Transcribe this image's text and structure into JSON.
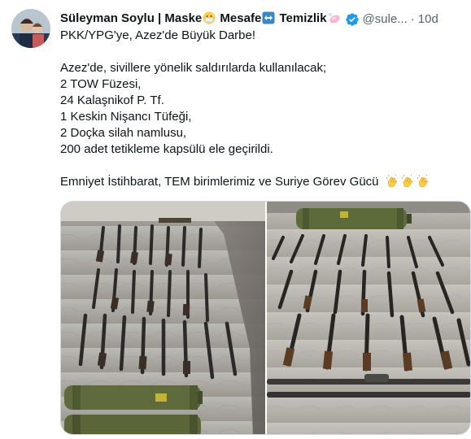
{
  "author": {
    "name_prefix": "Süleyman Soylu | Maske",
    "name_mid": " Mesafe",
    "name_suffix": " Temizlik",
    "handle": "@sule...",
    "separator": "·",
    "time": "10d"
  },
  "icons": {
    "mask_emoji": "face-with-medical-mask-icon",
    "arrow_emoji": "left-right-arrow-icon",
    "soap_emoji": "soap-icon",
    "verified": "verified-badge-icon",
    "clap": "clapping-hands-icon"
  },
  "colors": {
    "verified_blue": "#1d9bf0",
    "secondary_text": "#536471",
    "text": "#0f1419"
  },
  "tweet": {
    "line1": "PKK/YPG'ye, Azez'de Büyük Darbe!",
    "line2": "Azez'de, sivillere yönelik saldırılarda kullanılacak;",
    "line3": "2 TOW Füzesi,",
    "line4": "24 Kalaşnikof P. Tf.",
    "line5": "1 Keskin Nişancı Tüfeği,",
    "line6": "2 Doçka silah namlusu,",
    "line7": "200 adet tetikleme kapsülü ele geçirildi.",
    "line8": "Emniyet İstihbarat, TEM birimlerimiz ve Suriye Görev Gücü"
  }
}
